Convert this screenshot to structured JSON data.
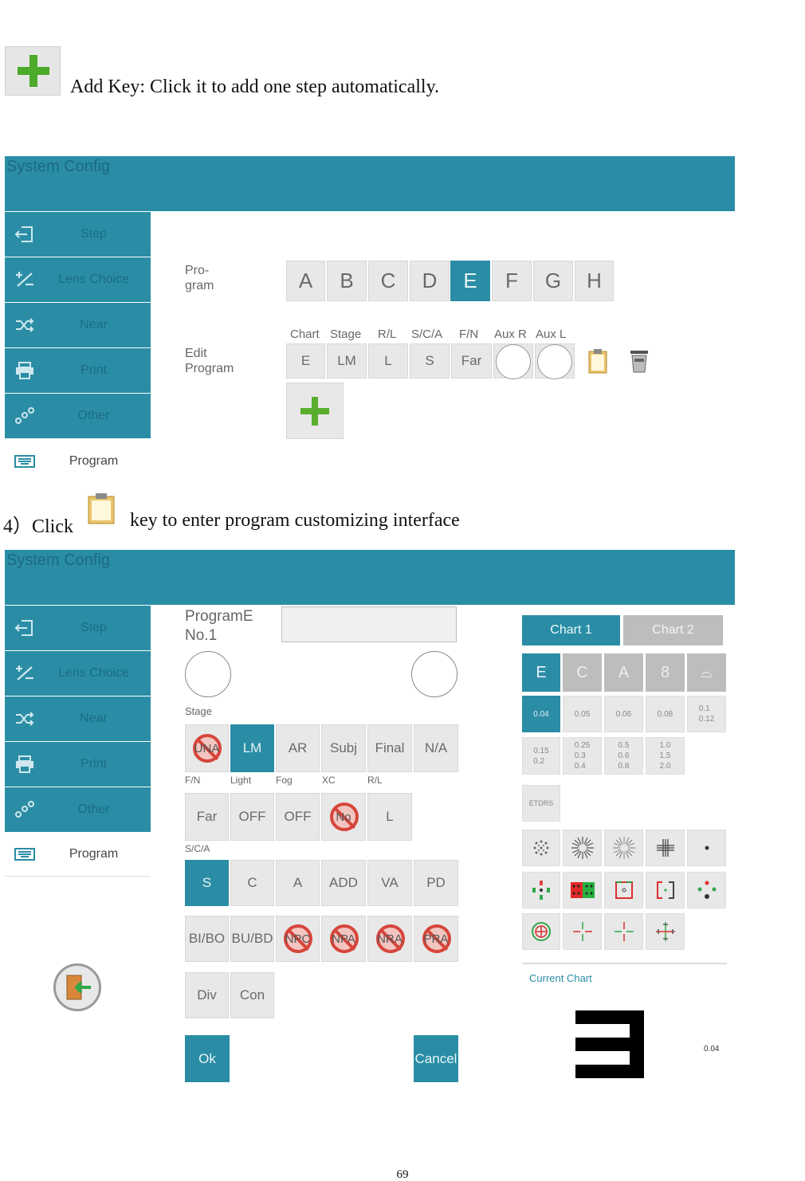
{
  "doc": {
    "add_key_text": "Add Key: Click it to add one step automatically.",
    "step_prefix": "4）Click",
    "step_suffix": "key to enter program customizing interface",
    "page_number": "69"
  },
  "screen1": {
    "title": "System Config",
    "sidebar": [
      {
        "label": "Step",
        "icon": "step-icon"
      },
      {
        "label": "Lens Choice",
        "icon": "plus-minus-icon"
      },
      {
        "label": "Near",
        "icon": "shuffle-icon"
      },
      {
        "label": "Print",
        "icon": "printer-icon"
      },
      {
        "label": "Other",
        "icon": "nodes-icon"
      },
      {
        "label": "Program",
        "icon": "keyboard-icon"
      }
    ],
    "program_label": "Pro-\ngram",
    "edit_label": "Edit\nProgram",
    "programs": [
      "A",
      "B",
      "C",
      "D",
      "E",
      "F",
      "G",
      "H"
    ],
    "selected_program": "E",
    "columns": [
      "Chart",
      "Stage",
      "R/L",
      "S/C/A",
      "F/N",
      "Aux R",
      "Aux L"
    ],
    "row": [
      "E",
      "LM",
      "L",
      "S",
      "Far"
    ]
  },
  "screen2": {
    "title": "System Config",
    "sidebar": [
      {
        "label": "Step",
        "icon": "step-icon"
      },
      {
        "label": "Lens Choice",
        "icon": "plus-minus-icon"
      },
      {
        "label": "Near",
        "icon": "shuffle-icon"
      },
      {
        "label": "Print",
        "icon": "printer-icon"
      },
      {
        "label": "Other",
        "icon": "nodes-icon"
      },
      {
        "label": "Program",
        "icon": "keyboard-icon"
      }
    ],
    "program_name": "ProgramE",
    "program_no": "No.1",
    "stage_label": "Stage",
    "stages": [
      "UNA",
      "LM",
      "AR",
      "Subj",
      "Final",
      "N/A"
    ],
    "row_labels": [
      "F/N",
      "Light",
      "Fog",
      "XC",
      "R/L"
    ],
    "options_row": [
      "Far",
      "OFF",
      "OFF",
      "No",
      "L"
    ],
    "sca_label": "S/C/A",
    "sca": [
      "S",
      "C",
      "A",
      "ADD",
      "VA",
      "PD"
    ],
    "prism": [
      "BI/BO",
      "BU/BD",
      "NPC",
      "NPA",
      "NRA",
      "PRA"
    ],
    "misc": [
      "Div",
      "Con"
    ],
    "ok_label": "Ok",
    "cancel_label": "Cancel",
    "chart_tabs": [
      "Chart 1",
      "Chart 2"
    ],
    "chart_types": [
      "E",
      "C",
      "A",
      "8",
      "⌓"
    ],
    "acuity_row1": [
      "0.04",
      "0.05",
      "0.06",
      "0.08",
      "0.1\n0.12"
    ],
    "acuity_row2": [
      "0.15\n0.2",
      "0.25\n0.3\n0.4",
      "0.5\n0.6\n0.8",
      "1.0\n1.5\n2.0"
    ],
    "etdrs": "ETDRS",
    "current_chart_label": "Current Chart",
    "current_value": "0.04"
  }
}
